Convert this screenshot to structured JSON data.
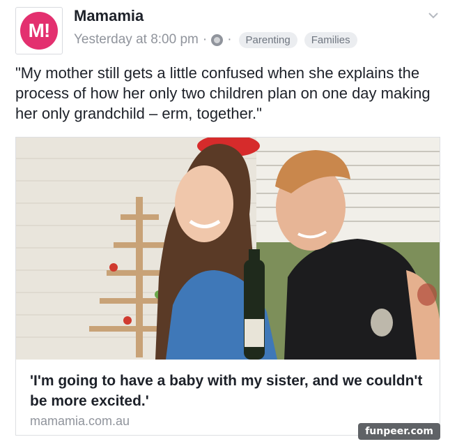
{
  "page": {
    "name": "Mamamia",
    "logo_text": "M!",
    "brand_color": "#e3306f"
  },
  "meta": {
    "timestamp": "Yesterday at 8:00 pm",
    "separator": "·",
    "privacy_icon": "globe-icon",
    "tags": [
      "Parenting",
      "Families"
    ]
  },
  "post": {
    "caption": "\"My mother still gets a little confused when she explains the process of how her only two children plan on one day making her only grandchild – erm, together.\""
  },
  "link": {
    "title": "'I'm going to have a baby with my sister, and we couldn't be more excited.'",
    "domain": "mamamia.com.au"
  },
  "watermark": "funpeer.com",
  "icons": {
    "menu": "chevron-down-icon"
  }
}
